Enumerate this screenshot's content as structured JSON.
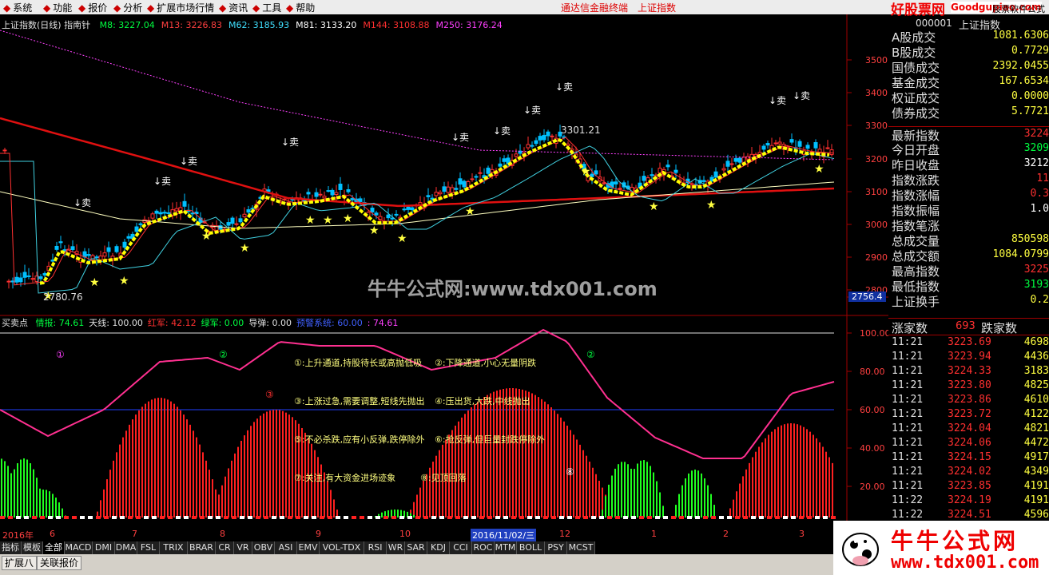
{
  "menu": {
    "items": [
      "系统",
      "功能",
      "报价",
      "分析",
      "扩展市场行情",
      "资讯",
      "工具",
      "帮助"
    ],
    "title_red_1": "通达信金融终端",
    "title_red_2": "上证指数",
    "brand_red": "好股票网",
    "brand_domain": "Goodgupiao.com",
    "brand_right": "股票软件公式"
  },
  "main_chart": {
    "header_title": "上证指数(日线) 指南针",
    "ma_labels": [
      {
        "text": "M8: 3227.04",
        "color": "#00ff40"
      },
      {
        "text": "M13: 3226.83",
        "color": "#ff4040"
      },
      {
        "text": "M62: 3185.93",
        "color": "#40e0ff"
      },
      {
        "text": "M81: 3133.20",
        "color": "#ffffff"
      },
      {
        "text": "M144: 3108.88",
        "color": "#ff3030"
      },
      {
        "text": "M250: 3176.24",
        "color": "#ff40ff"
      }
    ],
    "y_ticks": [
      "3500",
      "3400",
      "3300",
      "3200",
      "3100",
      "3000",
      "2900",
      "2800"
    ],
    "current_price_label": "2756.4",
    "high_label": "3301.21",
    "low_label": "2780.76",
    "sell_label": "卖",
    "watermark": "牛牛公式网:www.tdx001.com"
  },
  "indicator": {
    "header_name": "买卖点",
    "labels": [
      {
        "text": "情报: 74.61",
        "color": "#00ff40"
      },
      {
        "text": "天线: 100.00",
        "color": "#e0e0e0"
      },
      {
        "text": "红军: 42.12",
        "color": "#ff3030"
      },
      {
        "text": "绿军: 0.00",
        "color": "#00ff40"
      },
      {
        "text": "导弹: 0.00",
        "color": "#e0e0e0"
      },
      {
        "text": "预警系统: 60.00",
        "color": "#4060ff"
      },
      {
        "text": ": 74.61",
        "color": "#ff40ff"
      }
    ],
    "y_ticks": [
      "100.00",
      "80.00",
      "60.00",
      "40.00",
      "20.00"
    ],
    "notes": [
      "①:上升通道,持股待长或高抛低吸",
      "②:下降通道,小心无量阴跌",
      "③:上涨过急,需要调整,短线先抛出",
      "④:压出货,大跌,中线抛出",
      "⑤:不必杀跌,应有小反弹,跌停除外",
      "⑥:抢反弹,但巨量封跌停除外",
      "⑦:关注,有大资金进场迹象",
      "⑧:见顶回落"
    ],
    "circle_marks": [
      "①",
      "②",
      "③",
      "②",
      "⑧"
    ]
  },
  "date_axis": {
    "year_label": "2016年",
    "months": [
      "6",
      "7",
      "8",
      "9",
      "10",
      "11",
      "12",
      "1",
      "2",
      "3"
    ],
    "cursor_date": "2016/11/02/三"
  },
  "quote_panel": {
    "code": "000001",
    "name": "上证指数",
    "rows": [
      {
        "label": "A股成交",
        "value": "1081.6306",
        "color": "#ffff40"
      },
      {
        "label": "B股成交",
        "value": "0.7729",
        "color": "#ffff40"
      },
      {
        "label": "国债成交",
        "value": "2392.0455",
        "color": "#ffff40"
      },
      {
        "label": "基金成交",
        "value": "167.6534",
        "color": "#ffff40"
      },
      {
        "label": "权证成交",
        "value": "0.0000",
        "color": "#ffff40"
      },
      {
        "label": "债券成交",
        "value": "5.7721",
        "color": "#ffff40"
      },
      {
        "label": "最新指数",
        "value": "3224",
        "color": "#ff3030"
      },
      {
        "label": "今日开盘",
        "value": "3209",
        "color": "#00ff40"
      },
      {
        "label": "昨日收盘",
        "value": "3212",
        "color": "#ffffff"
      },
      {
        "label": "指数涨跌",
        "value": "11",
        "color": "#ff3030"
      },
      {
        "label": "指数涨幅",
        "value": "0.3",
        "color": "#ff3030"
      },
      {
        "label": "指数振幅",
        "value": "1.0",
        "color": "#ffffff"
      },
      {
        "label": "指数笔涨",
        "value": "",
        "color": "#ffffff"
      },
      {
        "label": "总成交量",
        "value": "850598",
        "color": "#ffff40"
      },
      {
        "label": "总成交额",
        "value": "1084.0799",
        "color": "#ffff40"
      },
      {
        "label": "最高指数",
        "value": "3225",
        "color": "#ff3030"
      },
      {
        "label": "最低指数",
        "value": "3193",
        "color": "#00ff40"
      },
      {
        "label": "上证换手",
        "value": "0.2",
        "color": "#ffff40"
      }
    ],
    "breadth": {
      "up_label": "涨家数",
      "up": "693",
      "down_label": "跌家数"
    },
    "ticks": [
      {
        "t": "11:21",
        "p": "3223.69",
        "v": "4698"
      },
      {
        "t": "11:21",
        "p": "3223.94",
        "v": "4436"
      },
      {
        "t": "11:21",
        "p": "3224.33",
        "v": "3183"
      },
      {
        "t": "11:21",
        "p": "3223.80",
        "v": "4825"
      },
      {
        "t": "11:21",
        "p": "3223.86",
        "v": "4610"
      },
      {
        "t": "11:21",
        "p": "3223.72",
        "v": "4122"
      },
      {
        "t": "11:21",
        "p": "3224.04",
        "v": "4821"
      },
      {
        "t": "11:21",
        "p": "3224.06",
        "v": "4472"
      },
      {
        "t": "11:21",
        "p": "3224.15",
        "v": "4917"
      },
      {
        "t": "11:21",
        "p": "3224.02",
        "v": "4349"
      },
      {
        "t": "11:21",
        "p": "3223.85",
        "v": "4191"
      },
      {
        "t": "11:22",
        "p": "3224.19",
        "v": "4191"
      },
      {
        "t": "11:22",
        "p": "3224.51",
        "v": "4596"
      }
    ]
  },
  "tabs": [
    "指标",
    "模板",
    "全部",
    "MACD",
    "DMI",
    "DMA",
    "FSL",
    "TRIX",
    "BRAR",
    "CR",
    "VR",
    "OBV",
    "ASI",
    "EMV",
    "VOL-TDX",
    "RSI",
    "WR",
    "SAR",
    "KDJ",
    "CCI",
    "ROC",
    "MTM",
    "BOLL",
    "PSY",
    "MCST"
  ],
  "bottom": {
    "expand_label": "扩展八",
    "linked_label": "关联报价"
  },
  "logo": {
    "text": "牛牛公式网",
    "url": "www.tdx001.com"
  }
}
